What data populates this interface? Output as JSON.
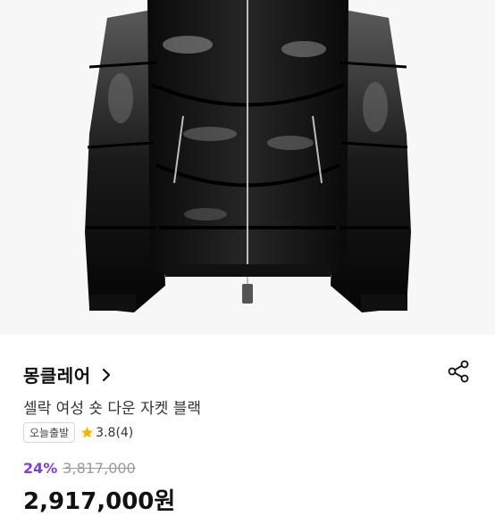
{
  "product": {
    "brand": "몽클레어",
    "title": "셀락 여성 숏 다운 자켓 블랙",
    "badge": "오늘출발",
    "rating": "3.8",
    "review_count": "(4)",
    "discount": "24%",
    "original_price": "3,817,000",
    "final_price": "2,917,000원"
  },
  "colors": {
    "accent": "#7b3fe4",
    "star": "#f5b400",
    "text": "#111111"
  },
  "icons": {
    "brand_link": "chevron-right-icon",
    "share": "share-icon",
    "rating": "star-icon"
  }
}
